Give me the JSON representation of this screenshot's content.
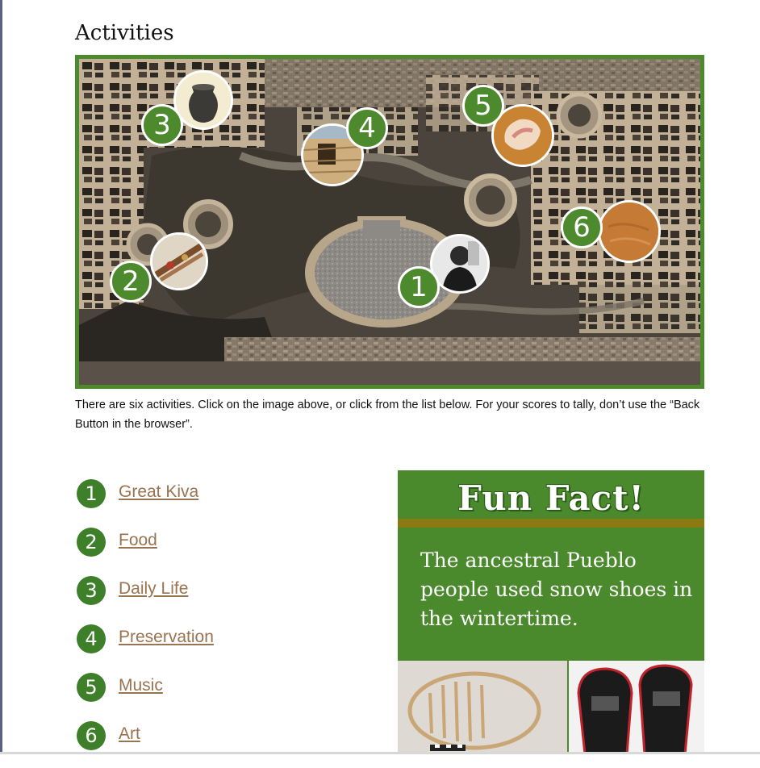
{
  "page": {
    "heading": "Activities",
    "intro": "There are six activities. Click on the image above, or click from the list below. For your scores to tally, don’t use the “Back Button in the browser”."
  },
  "colors": {
    "accent_green": "#4d8a2e",
    "badge_green": "#3e7f29",
    "link_brown": "#9a7350",
    "fact_band": "#8b7a10"
  },
  "map": {
    "markers": [
      {
        "number": "1",
        "photo_icon": "portrait-photo-icon"
      },
      {
        "number": "2",
        "photo_icon": "food-photo-icon"
      },
      {
        "number": "3",
        "photo_icon": "pot-photo-icon"
      },
      {
        "number": "4",
        "photo_icon": "wall-photo-icon"
      },
      {
        "number": "5",
        "photo_icon": "shell-photo-icon"
      },
      {
        "number": "6",
        "photo_icon": "art-photo-icon"
      }
    ]
  },
  "activities": [
    {
      "number": "1",
      "label": "Great Kiva"
    },
    {
      "number": "2",
      "label": "Food"
    },
    {
      "number": "3",
      "label": "Daily Life"
    },
    {
      "number": "4",
      "label": "Preservation"
    },
    {
      "number": "5",
      "label": "Music"
    },
    {
      "number": "6",
      "label": "Art"
    }
  ],
  "fun_fact": {
    "title": "Fun Fact!",
    "text": "The ancestral Pueblo people used snow shoes in the wintertime."
  }
}
